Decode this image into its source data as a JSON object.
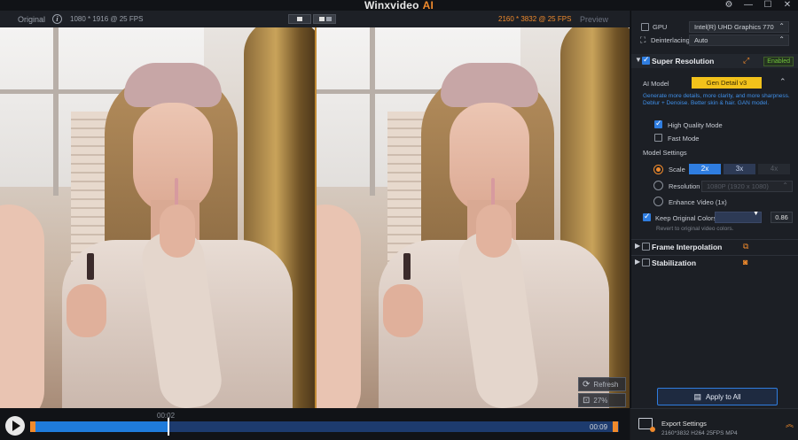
{
  "window": {
    "title": "Winxvideo",
    "title_ai": "AI",
    "controls": {
      "settings": "⚙",
      "minimize": "—",
      "maximize": "☐",
      "close": "✕"
    }
  },
  "preview": {
    "original_label": "Original",
    "original_resolution": "1080 * 1916 @ 25 FPS",
    "preview_label": "Preview",
    "preview_resolution": "2160 * 3832 @ 25 FPS",
    "refresh_label": "Refresh",
    "zoom_label": "27%"
  },
  "timeline": {
    "current_time": "00:02",
    "end_time": "00:09",
    "progress_fraction": 0.23
  },
  "panel": {
    "gpu_label": "GPU",
    "gpu_value": "Intel(R) UHD Graphics 770",
    "deinterlacing_label": "Deinterlacing",
    "deinterlacing_value": "Auto",
    "super_resolution": {
      "title": "Super Resolution",
      "badge": "Enabled",
      "ai_model_label": "AI Model",
      "ai_model_value": "Gen Detail v3",
      "description": "Generate more details, more clarity, and more sharpness. Deblur + Denoise. Better skin & hair. GAN model.",
      "high_quality_label": "High Quality Mode",
      "fast_mode_label": "Fast Mode",
      "model_settings_label": "Model Settings",
      "scale_label": "Scale",
      "scale_options": [
        "2x",
        "3x",
        "4x"
      ],
      "resolution_label": "Resolution",
      "resolution_value": "1080P (1920 x 1080)",
      "enhance_label": "Enhance Video (1x)",
      "keep_colors_label": "Keep Original Colors",
      "keep_colors_value": "0.86",
      "revert_text": "Revert to original video colors."
    },
    "frame_interpolation_title": "Frame Interpolation",
    "stabilization_title": "Stabilization",
    "apply_all_label": "Apply to All"
  },
  "export": {
    "title": "Export Settings",
    "info": "2160*3832  H264  25FPS  MP4"
  },
  "colors": {
    "accent_orange": "#f08a2c",
    "accent_blue": "#2f7de0",
    "model_yellow": "#f2c21b",
    "enabled_green": "#6fc23a"
  }
}
